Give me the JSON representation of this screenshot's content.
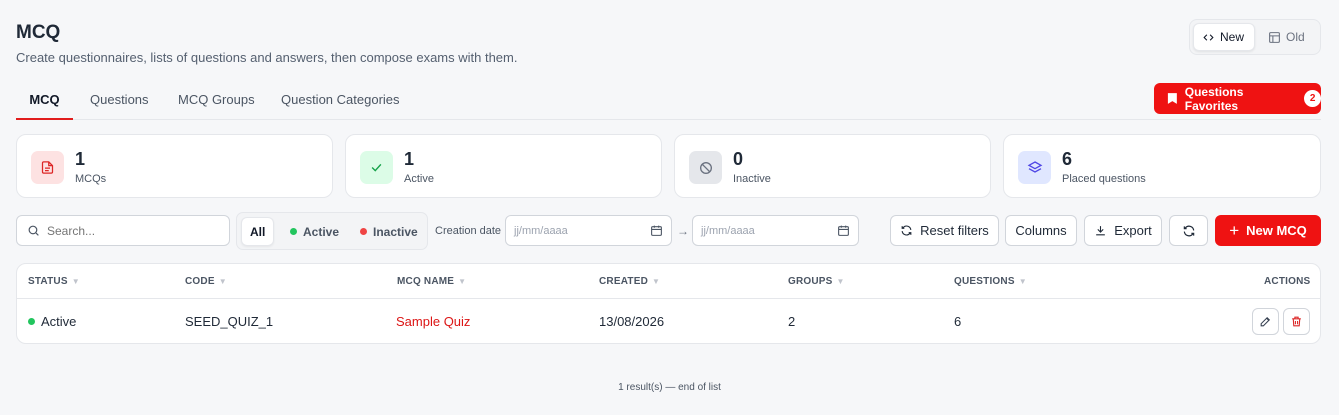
{
  "header": {
    "title": "MCQ",
    "subtitle": "Create questionnaires, lists of questions and answers, then compose exams with them."
  },
  "view_toggle": {
    "new_label": "New",
    "old_label": "Old",
    "selected": "New"
  },
  "tabs": [
    {
      "label": "MCQ",
      "active": true
    },
    {
      "label": "Questions",
      "active": false
    },
    {
      "label": "MCQ Groups",
      "active": false
    },
    {
      "label": "Question Categories",
      "active": false
    }
  ],
  "favorites": {
    "label": "Questions Favorites",
    "count": "2"
  },
  "stats": [
    {
      "value": "1",
      "label": "MCQs",
      "icon": "document-icon",
      "color": "#dc2626"
    },
    {
      "value": "1",
      "label": "Active",
      "icon": "check-icon",
      "color": "#16a34a"
    },
    {
      "value": "0",
      "label": "Inactive",
      "icon": "ban-icon",
      "color": "#6b7280"
    },
    {
      "value": "6",
      "label": "Placed questions",
      "icon": "layers-icon",
      "color": "#4f46e5"
    }
  ],
  "filters": {
    "search_placeholder": "Search...",
    "status_options": [
      "All",
      "Active",
      "Inactive"
    ],
    "status_selected": "All",
    "date_label": "Creation date",
    "date_from_placeholder": "jj/mm/aaaa",
    "date_to_placeholder": "jj/mm/aaaa",
    "arrow": "→"
  },
  "toolbar": {
    "reset_label": "Reset filters",
    "columns_label": "Columns",
    "export_label": "Export",
    "new_label": "New MCQ"
  },
  "table": {
    "columns": [
      "STATUS",
      "CODE",
      "MCQ NAME",
      "CREATED",
      "GROUPS",
      "QUESTIONS",
      "ACTIONS"
    ],
    "rows": [
      {
        "status": "Active",
        "code": "SEED_QUIZ_1",
        "name": "Sample Quiz",
        "created": "13/08/2026",
        "groups": "2",
        "questions": "6"
      }
    ]
  },
  "footer": {
    "text": "1 result(s) — end of list"
  },
  "colors": {
    "accent": "#ef1212",
    "active": "#22c55e",
    "inactive": "#ef4444"
  }
}
